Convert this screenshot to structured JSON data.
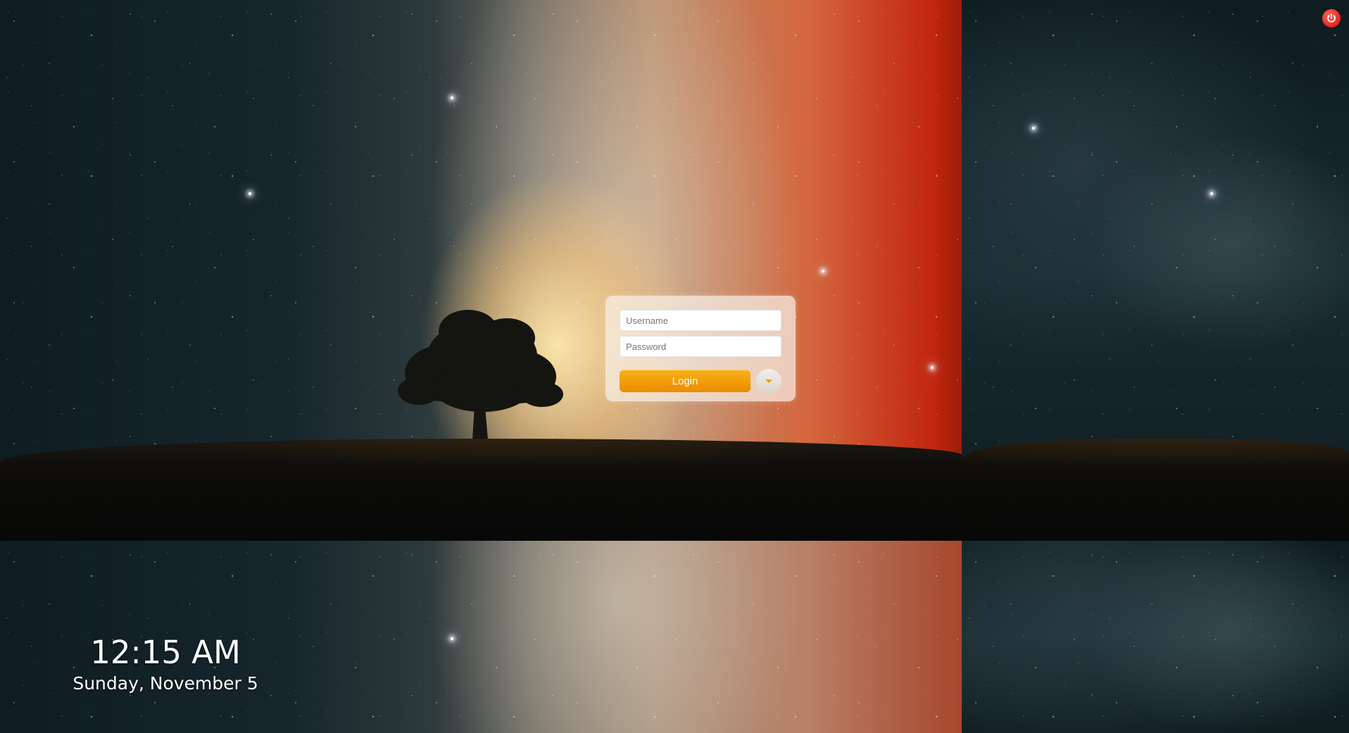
{
  "login": {
    "username_placeholder": "Username",
    "password_placeholder": "Password",
    "login_label": "Login"
  },
  "clock": {
    "time": "12:15 AM",
    "date": "Sunday, November 5"
  },
  "icons": {
    "power": "power-icon",
    "session": "chevron-down-icon"
  },
  "colors": {
    "accent": "#f29c06",
    "power": "#e3231c"
  }
}
